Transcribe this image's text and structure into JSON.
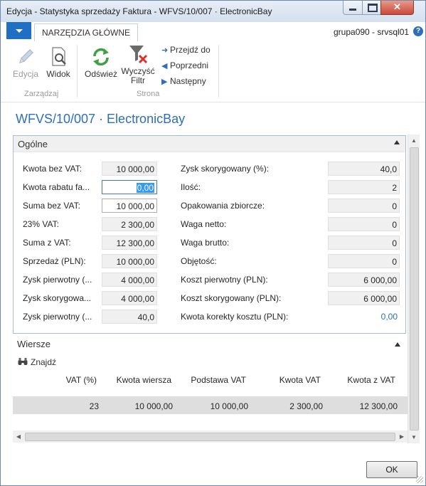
{
  "window": {
    "title": "Edycja - Statystyka sprzedaży Faktura - WFVS/10/007 · ElectronicBay",
    "close_glyph": "✕"
  },
  "ribbon": {
    "tab": "NARZĘDZIA GŁÓWNE",
    "user": "grupa090 - srvsql01",
    "help": "?",
    "buttons": {
      "edit": "Edycja",
      "view": "Widok",
      "refresh": "Odśwież",
      "clear_filter_l1": "Wyczyść",
      "clear_filter_l2": "Filtr",
      "goto": "Przejdź do",
      "previous": "Poprzedni",
      "next": "Następny"
    },
    "groups": {
      "manage": "Zarządzaj",
      "page": "Strona"
    },
    "icons": [
      "pencil-icon",
      "view-icon",
      "refresh-icon",
      "clear-filter-icon",
      "arrow-right-icon",
      "triangle-left-icon",
      "triangle-right-icon"
    ]
  },
  "page_title": "WFVS/10/007 · ElectronicBay",
  "general": {
    "header": "Ogólne",
    "left": [
      {
        "label": "Kwota bez VAT:",
        "value": "10 000,00"
      },
      {
        "label": "Kwota rabatu fa...",
        "value": "0,00"
      },
      {
        "label": "Suma bez VAT:",
        "value": "10 000,00"
      },
      {
        "label": "23% VAT:",
        "value": "2 300,00"
      },
      {
        "label": "Suma z VAT:",
        "value": "12 300,00"
      },
      {
        "label": "Sprzedaż (PLN):",
        "value": "10 000,00"
      },
      {
        "label": "Zysk pierwotny (...",
        "value": "4 000,00"
      },
      {
        "label": "Zysk skorygowa...",
        "value": "4 000,00"
      },
      {
        "label": "Zysk pierwotny (...",
        "value": "40,0"
      }
    ],
    "right": [
      {
        "label": "Zysk skorygowany (%):",
        "value": "40,0"
      },
      {
        "label": "Ilość:",
        "value": "2"
      },
      {
        "label": "Opakowania zbiorcze:",
        "value": "0"
      },
      {
        "label": "Waga netto:",
        "value": "0"
      },
      {
        "label": "Waga brutto:",
        "value": "0"
      },
      {
        "label": "Objętość:",
        "value": "0"
      },
      {
        "label": "Koszt pierwotny (PLN):",
        "value": "6 000,00"
      },
      {
        "label": "Koszt skorygowany (PLN):",
        "value": "6 000,00"
      },
      {
        "label": "Kwota korekty kosztu (PLN):",
        "value": "0,00"
      }
    ]
  },
  "lines": {
    "header": "Wiersze",
    "find": "Znajdź",
    "columns": [
      "VAT (%)",
      "Kwota wiersza",
      "Podstawa VAT",
      "Kwota VAT",
      "Kwota z VAT"
    ],
    "rows": [
      [
        "23",
        "10 000,00",
        "10 000,00",
        "2 300,00",
        "12 300,00"
      ]
    ]
  },
  "ok_button": "OK",
  "colors": {
    "accent": "#2d6fba",
    "app_menu": "#1f6fc5"
  }
}
